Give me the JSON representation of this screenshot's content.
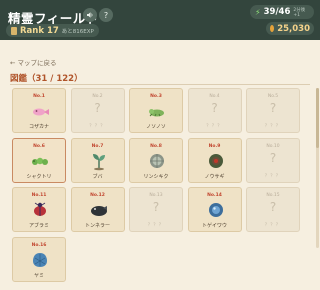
{
  "header": {
    "title": "精霊フィールド",
    "sound_icon": "speaker-icon",
    "help_label": "?",
    "rank_label": "Rank 17",
    "rank_sub": "あと816EXP",
    "stamina_value": "39/46",
    "stamina_sub": "2分後+1",
    "coins_value": "25,030"
  },
  "nav": {
    "back_label": "← マップに戻る"
  },
  "collection": {
    "heading": "図鑑（31 / 122）",
    "cards": [
      {
        "num": "No.1",
        "name": "コザカナ",
        "locked": false,
        "art": "pink-fish"
      },
      {
        "num": "No.2",
        "name": "？？？",
        "locked": true
      },
      {
        "num": "No.3",
        "name": "ノソノソ",
        "locked": false,
        "art": "green-lizard"
      },
      {
        "num": "No.4",
        "name": "？？？",
        "locked": true
      },
      {
        "num": "No.5",
        "name": "？？？",
        "locked": true
      },
      {
        "num": "No.6",
        "name": "シャクトリ",
        "locked": false,
        "art": "green-caterpillar",
        "selected": true
      },
      {
        "num": "No.7",
        "name": "ブバ",
        "locked": false,
        "art": "teal-plant"
      },
      {
        "num": "No.8",
        "name": "リンシキク",
        "locked": false,
        "art": "gray-orb"
      },
      {
        "num": "No.9",
        "name": "ノウサギ",
        "locked": false,
        "art": "nest"
      },
      {
        "num": "No.10",
        "name": "？？？",
        "locked": true
      },
      {
        "num": "No.11",
        "name": "アブラミ",
        "locked": false,
        "art": "red-beetle"
      },
      {
        "num": "No.12",
        "name": "トンネラー",
        "locked": false,
        "art": "dark-mole"
      },
      {
        "num": "No.13",
        "name": "？？？",
        "locked": true
      },
      {
        "num": "No.14",
        "name": "トゲイワウ",
        "locked": false,
        "art": "blue-orb"
      },
      {
        "num": "No.15",
        "name": "？？？",
        "locked": true
      },
      {
        "num": "No.16",
        "name": "ヤミ",
        "locked": false,
        "art": "blue-shell"
      }
    ]
  },
  "colors": {
    "header_bg": "#33453d",
    "page_bg": "#f6efe0",
    "accent": "#b0542a"
  }
}
